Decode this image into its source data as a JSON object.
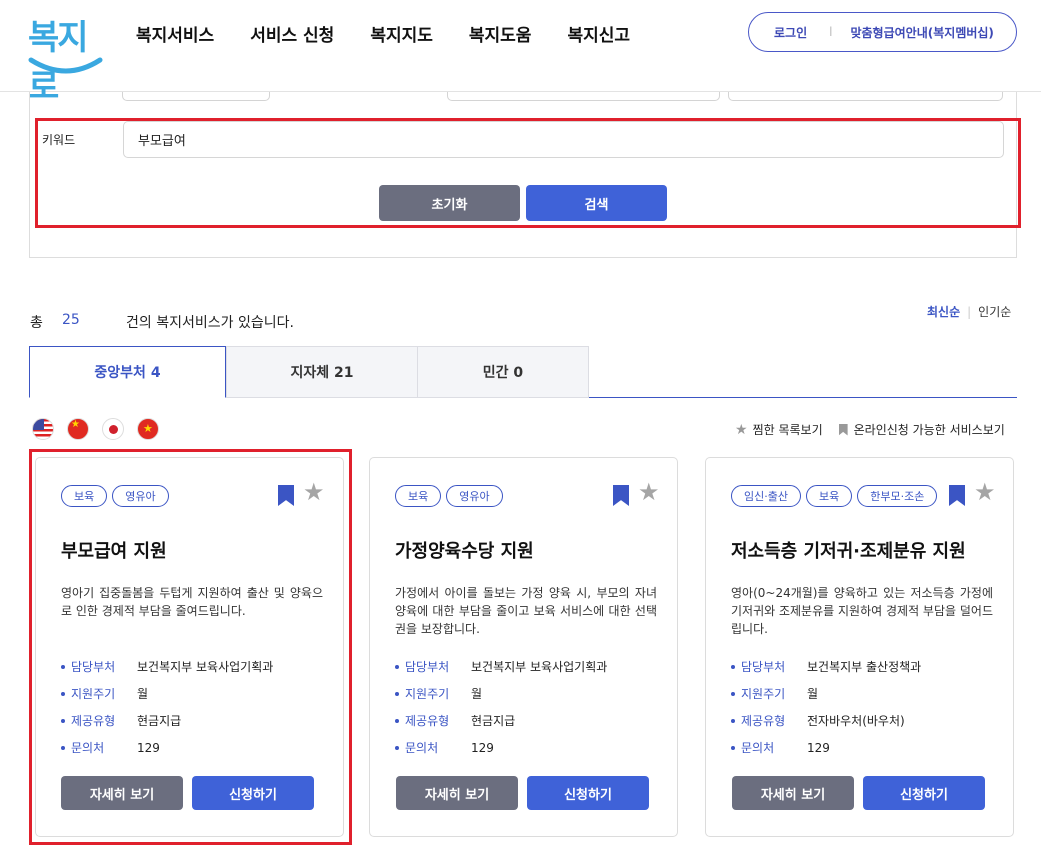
{
  "header": {
    "logo_text": "복지로",
    "nav": [
      "복지서비스",
      "서비스 신청",
      "복지지도",
      "복지도움",
      "복지신고"
    ],
    "login": "로그인",
    "separator": "l",
    "custom_service": "맞춤형급여안내(복지멤버십)"
  },
  "search": {
    "keyword_label": "키워드",
    "keyword_value": "부모급여",
    "reset_label": "초기화",
    "search_label": "검색"
  },
  "results": {
    "total_label": "총",
    "total_count": "25",
    "suffix": "건의 복지서비스가 있습니다.",
    "sort_latest": "최신순",
    "sort_popular": "인기순"
  },
  "tabs": [
    {
      "label": "중앙부처 4",
      "active": true
    },
    {
      "label": "지자체 21",
      "active": false
    },
    {
      "label": "민간 0",
      "active": false
    }
  ],
  "view_options": {
    "favorites": "찜한 목록보기",
    "online": "온라인신청 가능한 서비스보기"
  },
  "flags": [
    "us-flag-icon",
    "china-flag-icon",
    "japan-flag-icon",
    "vietnam-flag-icon"
  ],
  "cards": [
    {
      "tags": [
        "보육",
        "영유아"
      ],
      "title": "부모급여 지원",
      "desc": "영아기 집중돌봄을 두텁게 지원하여 출산 및 양육으로 인한 경제적 부담을 줄여드립니다.",
      "info": [
        {
          "k": "담당부처",
          "v": "보건복지부 보육사업기획과"
        },
        {
          "k": "지원주기",
          "v": "월"
        },
        {
          "k": "제공유형",
          "v": "현금지급"
        },
        {
          "k": "문의처",
          "v": "129"
        }
      ],
      "detail": "자세히 보기",
      "apply": "신청하기"
    },
    {
      "tags": [
        "보육",
        "영유아"
      ],
      "title": "가정양육수당 지원",
      "desc": "가정에서 아이를 돌보는 가정 양육 시, 부모의 자녀 양육에 대한 부담을 줄이고 보육 서비스에 대한 선택권을 보장합니다.",
      "info": [
        {
          "k": "담당부처",
          "v": "보건복지부 보육사업기획과"
        },
        {
          "k": "지원주기",
          "v": "월"
        },
        {
          "k": "제공유형",
          "v": "현금지급"
        },
        {
          "k": "문의처",
          "v": "129"
        }
      ],
      "detail": "자세히 보기",
      "apply": "신청하기"
    },
    {
      "tags": [
        "임신·출산",
        "보육",
        "한부모·조손"
      ],
      "title": "저소득층 기저귀·조제분유 지원",
      "desc": "영아(0~24개월)를 양육하고 있는 저소득층 가정에 기저귀와 조제분유를 지원하여 경제적 부담을 덜어드립니다.",
      "info": [
        {
          "k": "담당부처",
          "v": "보건복지부 출산정책과"
        },
        {
          "k": "지원주기",
          "v": "월"
        },
        {
          "k": "제공유형",
          "v": "전자바우처(바우처)"
        },
        {
          "k": "문의처",
          "v": "129"
        }
      ],
      "detail": "자세히 보기",
      "apply": "신청하기"
    }
  ],
  "colors": {
    "accent": "#3b55c4",
    "button_blue": "#3f62d8",
    "button_gray": "#6b6e7f",
    "highlight_red": "#e0202c"
  }
}
